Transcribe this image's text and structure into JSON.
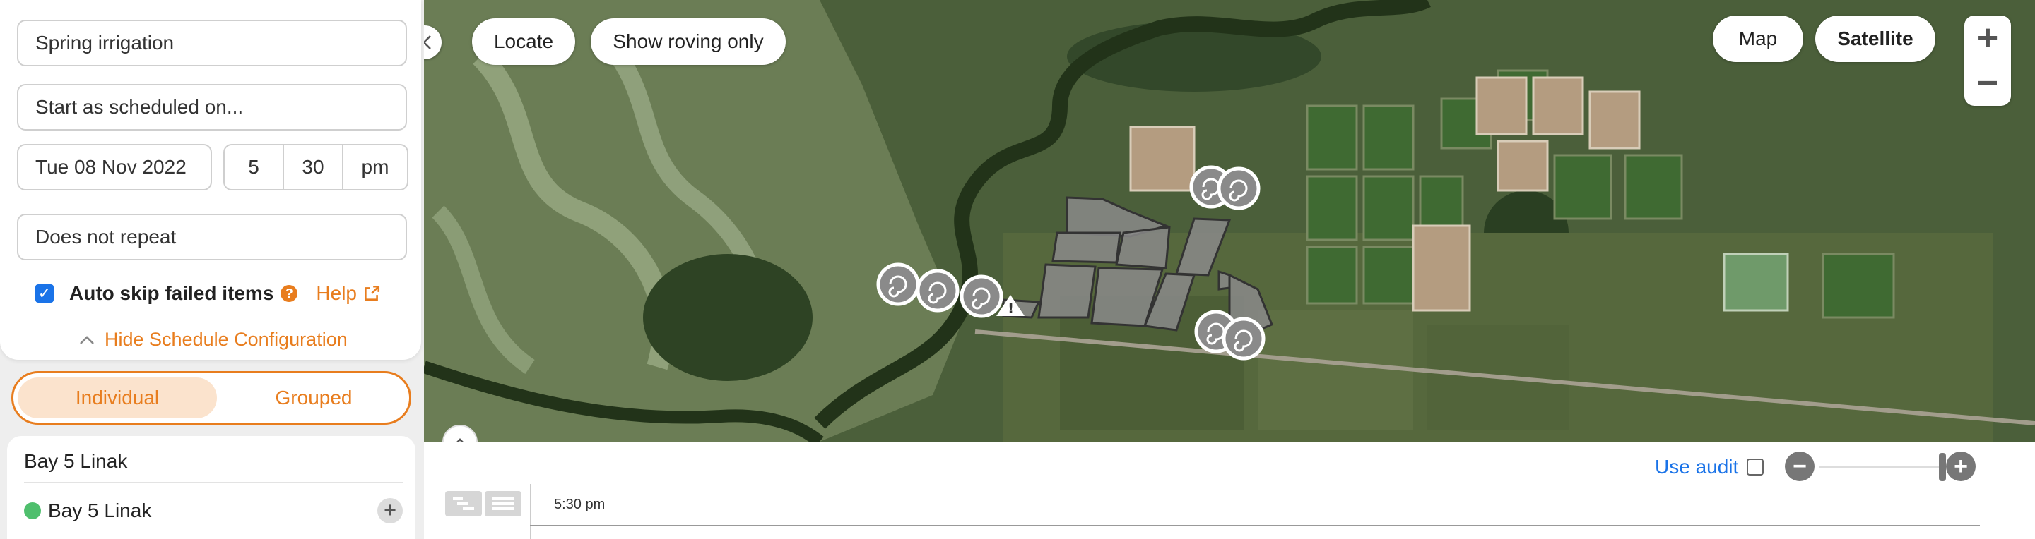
{
  "schedule": {
    "name": "Spring irrigation",
    "start_mode": "Start as scheduled on...",
    "date": "Tue 08 Nov 2022",
    "hour": "5",
    "minute": "30",
    "ampm": "pm",
    "repeat": "Does not repeat",
    "auto_skip_label": "Auto skip failed items",
    "auto_skip_checked": true,
    "help_label": "Help",
    "hide_config_label": "Hide Schedule Configuration"
  },
  "view_toggle": {
    "individual_label": "Individual",
    "grouped_label": "Grouped",
    "selected": "Individual"
  },
  "list": {
    "group_header": "Bay 5 Linak",
    "items": [
      {
        "label": "Bay 5 Linak",
        "status_color": "#4fbf6d"
      }
    ]
  },
  "map": {
    "locate_label": "Locate",
    "roving_label": "Show roving only",
    "map_label": "Map",
    "satellite_label": "Satellite",
    "active_type": "Satellite",
    "zoom_in": "+",
    "zoom_out": "−"
  },
  "timeline": {
    "use_audit_label": "Use audit",
    "use_audit_checked": false,
    "time_label": "5:30 pm"
  },
  "colors": {
    "accent": "#e87d1e",
    "link": "#1a73e8",
    "status_ok": "#4fbf6d"
  }
}
